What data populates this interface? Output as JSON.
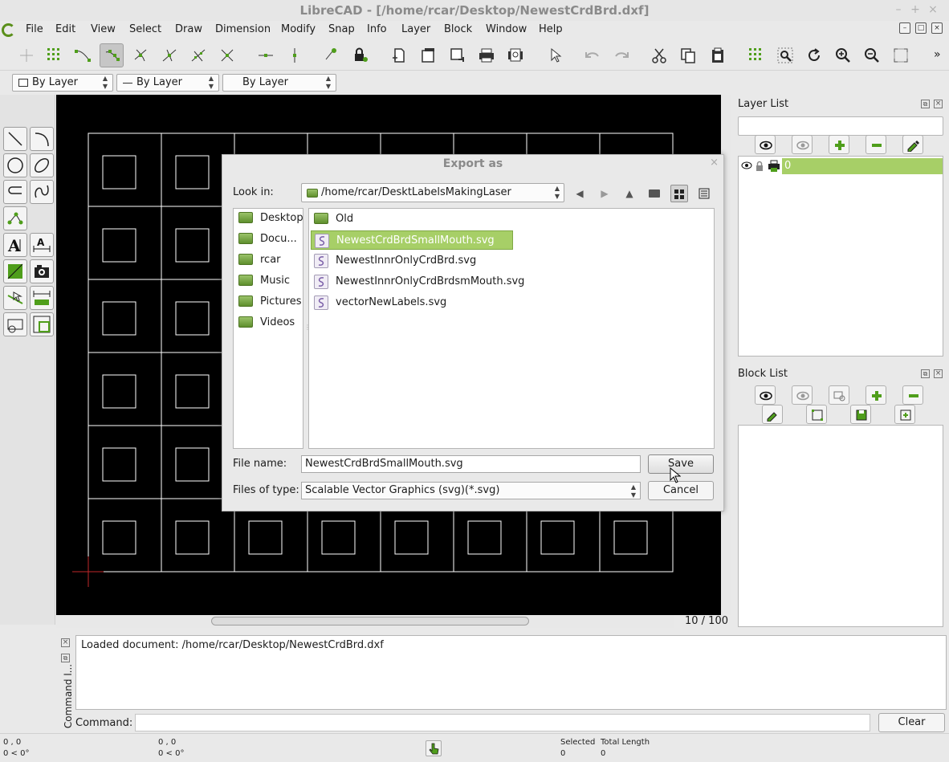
{
  "window": {
    "title": "LibreCAD - [/home/rcar/Desktop/NewestCrdBrd.dxf]",
    "controls": [
      "–",
      "+",
      "×"
    ]
  },
  "menu": [
    "File",
    "Edit",
    "View",
    "Select",
    "Draw",
    "Dimension",
    "Modify",
    "Snap",
    "Info",
    "Layer",
    "Block",
    "Window",
    "Help"
  ],
  "mdi_controls": [
    "–",
    "□",
    "×"
  ],
  "toolbar": {
    "overflow": "»",
    "icons": [
      "snap-free-icon",
      "snap-grid-icon",
      "snap-endpoint-icon",
      "snap-on-entity-icon",
      "snap-center-icon",
      "snap-middle-icon",
      "snap-distance-icon",
      "snap-intersection-icon",
      "restrict-horizontal-icon",
      "restrict-vertical-icon",
      "relative-zero-icon",
      "lock-relative-zero-icon",
      "new-document-icon",
      "open-icon",
      "save-icon",
      "print-icon",
      "print-preview-icon",
      "select-pointer-icon",
      "undo-icon",
      "redo-icon",
      "cut-icon",
      "copy-icon",
      "paste-icon",
      "grid-icon",
      "zoom-window-icon",
      "redraw-icon",
      "zoom-in-icon",
      "zoom-out-icon",
      "zoom-auto-icon"
    ]
  },
  "properties": {
    "color": "By Layer",
    "linetype": "By Layer",
    "linewidth": "By Layer"
  },
  "canvas": {
    "zoom": "10 / 100"
  },
  "layer_list": {
    "title": "Layer List",
    "filter_value": "",
    "layers": [
      {
        "name": "0"
      }
    ]
  },
  "block_list": {
    "title": "Block List"
  },
  "command": {
    "title": "Command l...",
    "log": "Loaded document: /home/rcar/Desktop/NewestCrdBrd.dxf",
    "label": "Command:",
    "value": "",
    "clear": "Clear"
  },
  "status": {
    "abs_coord": "0 , 0",
    "abs_polar": "0 < 0°",
    "rel_coord": "0 , 0",
    "rel_polar": "0 < 0°",
    "selected_label": "Selected",
    "selected_value": "0",
    "length_label": "Total Length",
    "length_value": "0"
  },
  "dialog": {
    "title": "Export as",
    "close": "×",
    "look_in_label": "Look in:",
    "look_in_value": "/home/rcar/DesktLabelsMakingLaser",
    "places": [
      "Desktop",
      "Docu...",
      "rcar",
      "Music",
      "Pictures",
      "Videos"
    ],
    "files": [
      {
        "name": "Old",
        "kind": "folder"
      },
      {
        "name": "NewestCrdBrdSmallMouth.svg",
        "kind": "svg",
        "selected": true
      },
      {
        "name": "NewestInnrOnlyCrdBrd.svg",
        "kind": "svg"
      },
      {
        "name": "NewestInnrOnlyCrdBrdsmMouth.svg",
        "kind": "svg"
      },
      {
        "name": "vectorNewLabels.svg",
        "kind": "svg"
      }
    ],
    "file_name_label": "File name:",
    "file_name_value": "NewestCrdBrdSmallMouth.svg",
    "file_type_label": "Files of type:",
    "file_type_value": "Scalable Vector Graphics (svg)(*.svg)",
    "save": "Save",
    "cancel": "Cancel"
  },
  "colors": {
    "accent": "#a7cf67",
    "canvas": "#000000"
  }
}
